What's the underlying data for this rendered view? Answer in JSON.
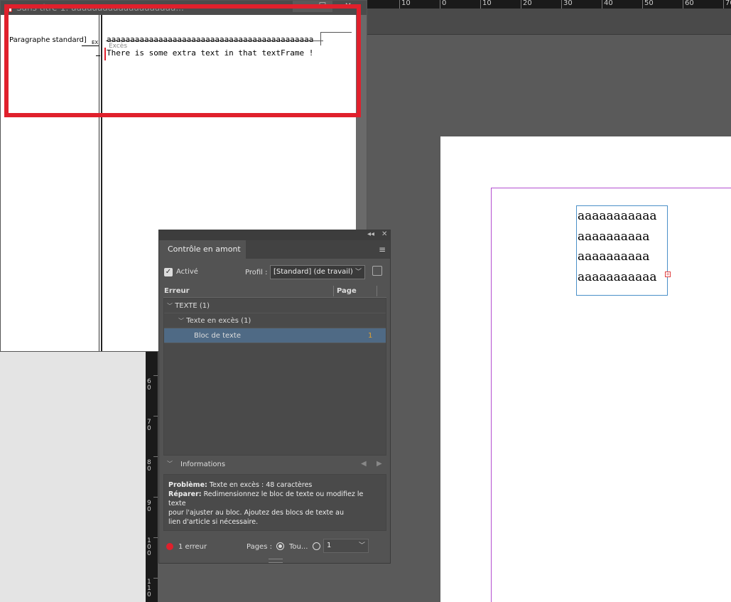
{
  "story_editor": {
    "title": "Sans titre-1: aaaaaaaaaaaaaaaaaaaa...",
    "paragraph_style": "Paragraphe standard]",
    "ex_marker": "EX",
    "line1": "aaaaaaaaaaaaaaaaaaaaaaaaaaaaaaaaaaaaaaaaaaaa",
    "overset_label": "Excès",
    "line2": "There is some extra text in that textFrame !",
    "buttons": [
      "‒",
      "☐",
      "✕"
    ]
  },
  "ruler": {
    "h_labels": [
      "10",
      "0",
      "10",
      "20",
      "30",
      "40",
      "50",
      "60",
      "70"
    ],
    "v_labels": [
      "6\n0",
      "7\n0",
      "8\n0",
      "9\n0",
      "1\n0\n0",
      "1\n1\n0"
    ]
  },
  "page_text": {
    "lines": [
      "aaaaaaaaaaa",
      "aaaaaaaaaa",
      "aaaaaaaaaa",
      "aaaaaaaaaaa"
    ],
    "overset_symbol": "+"
  },
  "preflight": {
    "panel_title": "Contrôle en amont",
    "active_label": "Activé",
    "profile_label": "Profil :",
    "profile_value": "[Standard] (de travail)",
    "col_error": "Erreur",
    "col_page": "Page",
    "rows": [
      {
        "label": "TEXTE (1)",
        "page": ""
      },
      {
        "label": "Texte en excès (1)",
        "page": ""
      },
      {
        "label": "Bloc de texte",
        "page": "1"
      }
    ],
    "info_title": "Informations",
    "problem_label": "Problème:",
    "problem_text": "Texte en excès : 48 caractères",
    "fix_label": "Réparer:",
    "fix_text_1": "Redimensionnez le bloc de texte ou modifiez le texte",
    "fix_text_2": "pour l'ajuster au bloc. Ajoutez des blocs de texte au",
    "fix_text_3": "lien d'article si nécessaire.",
    "error_count": "1 erreur",
    "pages_label": "Pages :",
    "all_label": "Tou...",
    "page_select": "1",
    "collapse_icon": "◂◂",
    "close_icon": "✕",
    "menu_icon": "≡"
  },
  "colors": {
    "error_red": "#e0202c",
    "selection_blue": "#4f6a85",
    "frame_blue": "#4a90c8",
    "margin_magenta": "#b34ed0",
    "page_number_orange": "#e0a030"
  }
}
